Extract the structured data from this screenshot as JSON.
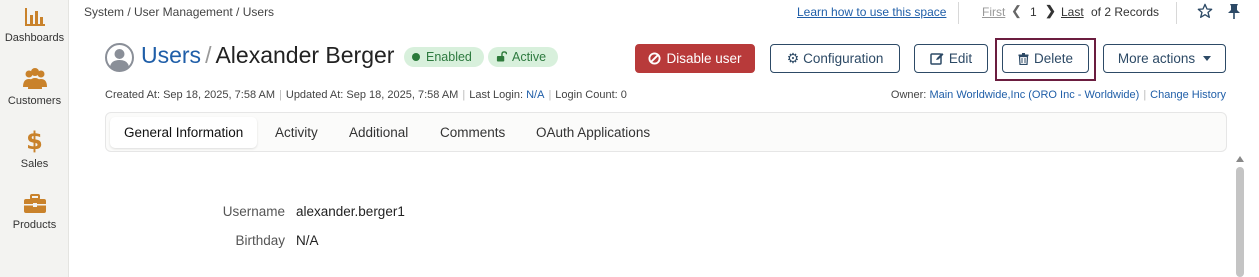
{
  "sidebar": {
    "items": [
      {
        "label": "Dashboards",
        "icon": "bar-chart-icon"
      },
      {
        "label": "Customers",
        "icon": "people-icon"
      },
      {
        "label": "Sales",
        "icon": "dollar-icon"
      },
      {
        "label": "Products",
        "icon": "briefcase-icon"
      }
    ]
  },
  "topbar": {
    "breadcrumb": "System / User Management / Users",
    "learn_link": "Learn how to use this space",
    "pager": {
      "first": "First",
      "page": "1",
      "last": "Last",
      "records": "of 2 Records"
    }
  },
  "header": {
    "title_section": "Users",
    "title_separator": "/",
    "title_name": "Alexander Berger",
    "badge_enabled": "Enabled",
    "badge_active": "Active",
    "buttons": {
      "disable": "Disable user",
      "configuration": "Configuration",
      "edit": "Edit",
      "delete": "Delete",
      "more": "More actions"
    }
  },
  "meta": {
    "created": "Created At: Sep 18, 2025, 7:58 AM",
    "updated": "Updated At: Sep 18, 2025, 7:58 AM",
    "last_login_label": "Last Login:",
    "last_login_value": "N/A",
    "login_count": "Login Count: 0",
    "owner_label": "Owner:",
    "owner_value": "Main Worldwide,Inc (ORO Inc - Worldwide)",
    "change_history": "Change History"
  },
  "tabs": [
    {
      "label": "General Information",
      "active": true
    },
    {
      "label": "Activity"
    },
    {
      "label": "Additional"
    },
    {
      "label": "Comments"
    },
    {
      "label": "OAuth Applications"
    }
  ],
  "fields": [
    {
      "label": "Username",
      "value": "alexander.berger1"
    },
    {
      "label": "Birthday",
      "value": "N/A"
    }
  ],
  "colors": {
    "brand_orange": "#c9822b",
    "link": "#1f5ea8",
    "danger": "#b83a3a",
    "focus_ring": "#6b1d3f"
  }
}
